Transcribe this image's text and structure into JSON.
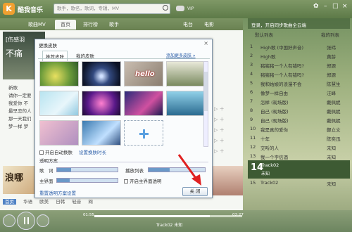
{
  "app": {
    "brand": "酷我音乐",
    "search_placeholder": "歌手，歌名，歌词，专辑，MV",
    "vip_label": "VIP"
  },
  "nav": {
    "tabs": [
      "歌曲MV",
      "首页",
      "排行榜",
      "歌手",
      "电台",
      "电影"
    ],
    "active_tab": "首页"
  },
  "banner": {
    "line1": "[伤感羽",
    "line2": "不痛"
  },
  "side_list": [
    "新歌",
    "请你一定要",
    "我爱你 不",
    "最早恋的人",
    "那一天我们",
    "梦一样 梦"
  ],
  "promo_text": "浪哪",
  "bottom_tabs": [
    "首页",
    "华语",
    "欧美",
    "日韩",
    "轻音",
    "网"
  ],
  "dialog": {
    "title": "更换皮肤",
    "close": "×",
    "tabs": [
      "推荐皮肤",
      "我的皮肤"
    ],
    "more_link": "添加更多皮肤 »",
    "skin_label_hello": "hello",
    "auto_change_label": "开启自动换肤",
    "auto_change_link": "设置换肤时长",
    "transparency_label": "透明方案",
    "rows": {
      "lyrics": "歌　词",
      "playlist": "播放列表",
      "main": "主界面",
      "main_check": "开启主界面透明"
    },
    "reset_link": "重置透明方案设置",
    "close_button": "关 闭"
  },
  "playlist": {
    "header": "登录，开启同步歌曲全云端",
    "tab_default": "默认列表",
    "tab_count": "",
    "tab_current": "我的列表",
    "songs": [
      {
        "n": "1",
        "title": "High歌 (中国好声音)",
        "artist": "张玮"
      },
      {
        "n": "2",
        "title": "High歌",
        "artist": "黄龄"
      },
      {
        "n": "3",
        "title": "猪猪猪一个人有错吗?",
        "artist": "郑源"
      },
      {
        "n": "4",
        "title": "猪猪猪一个人有错吗?",
        "artist": "郑源"
      },
      {
        "n": "5",
        "title": "我和姑娘的浪漫不会",
        "artist": "陈慧生"
      },
      {
        "n": "6",
        "title": "像梦一样自由",
        "artist": "汪峰"
      },
      {
        "n": "7",
        "title": "怎样 (现场版)",
        "artist": "戴佩妮"
      },
      {
        "n": "8",
        "title": "自己 (现场版)",
        "artist": "戴佩妮"
      },
      {
        "n": "9",
        "title": "自己 (现场版)",
        "artist": "戴佩妮"
      },
      {
        "n": "10",
        "title": "我是真的爱你",
        "artist": "鄭立文"
      },
      {
        "n": "11",
        "title": "十年",
        "artist": "陈奕迅"
      },
      {
        "n": "12",
        "title": "交听的人",
        "artist": "未知"
      },
      {
        "n": "13",
        "title": "我一个字信酒",
        "artist": "未知"
      }
    ],
    "now_playing": {
      "n": "14",
      "title": "Track02",
      "artist": "未知"
    },
    "next": {
      "n": "15",
      "title": "Track02",
      "artist": "未知"
    }
  },
  "player": {
    "elapsed": "01:55",
    "total": "02:27",
    "track": "Track02  未知",
    "progress": 0.78
  }
}
